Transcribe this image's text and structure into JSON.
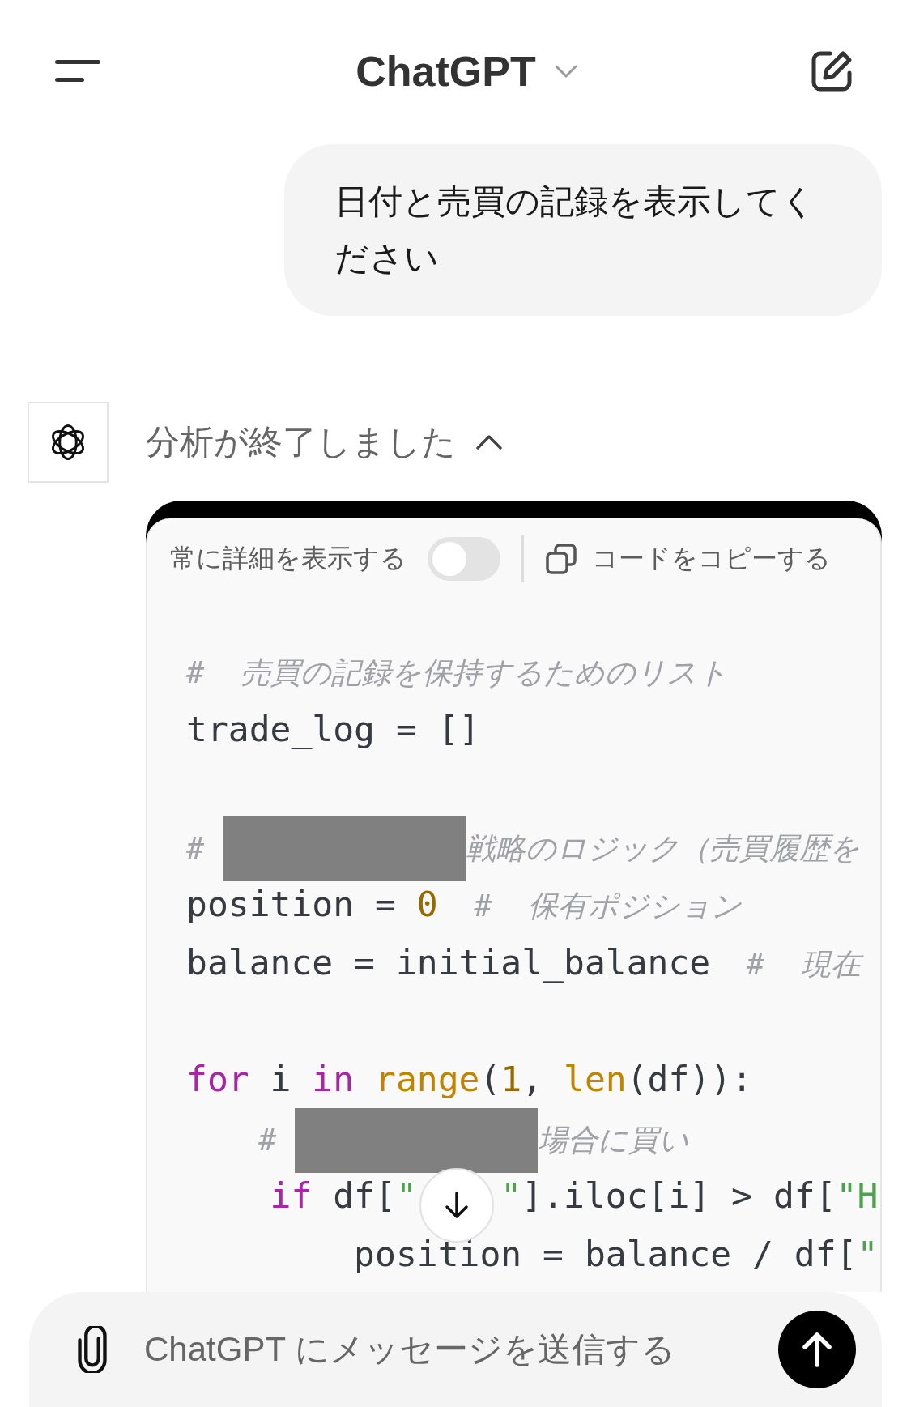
{
  "header": {
    "title": "ChatGPT"
  },
  "user_message": "日付と売買の記録を表示してください",
  "assistant": {
    "status": "分析が終了しました",
    "expanded": true,
    "code_panel": {
      "toggle": {
        "label": "常に詳細を表示する",
        "on": false
      },
      "copy_label": "コードをコピーする",
      "lines": [
        {
          "kind": "code",
          "tokens": [
            {
              "kind": "comment",
              "text": "#  売買の記録を保持するためのリスト"
            }
          ]
        },
        {
          "kind": "code",
          "tokens": [
            {
              "kind": "plain",
              "text": "trade_log = []"
            }
          ]
        },
        {
          "kind": "blank"
        },
        {
          "kind": "code",
          "tokens": [
            {
              "kind": "comment",
              "text": "# "
            },
            {
              "kind": "redacted"
            },
            {
              "kind": "comment",
              "text": "戦略のロジック（売買履歴を"
            }
          ]
        },
        {
          "kind": "code",
          "tokens": [
            {
              "kind": "plain",
              "text": "position = "
            },
            {
              "kind": "number",
              "text": "0"
            },
            {
              "kind": "comment",
              "text": "  #  保有ポジション"
            }
          ]
        },
        {
          "kind": "code",
          "tokens": [
            {
              "kind": "plain",
              "text": "balance = initial_balance"
            },
            {
              "kind": "comment",
              "text": "  #  現在"
            }
          ]
        },
        {
          "kind": "blank"
        },
        {
          "kind": "code",
          "tokens": [
            {
              "kind": "keyword",
              "text": "for"
            },
            {
              "kind": "plain",
              "text": " i "
            },
            {
              "kind": "keyword",
              "text": "in"
            },
            {
              "kind": "builtin",
              "text": " range"
            },
            {
              "kind": "plain",
              "text": "("
            },
            {
              "kind": "number",
              "text": "1"
            },
            {
              "kind": "plain",
              "text": ", "
            },
            {
              "kind": "builtin",
              "text": "len"
            },
            {
              "kind": "plain",
              "text": "(df)):"
            }
          ]
        },
        {
          "kind": "code",
          "tokens": [
            {
              "kind": "comment",
              "text": "    # "
            },
            {
              "kind": "redacted"
            },
            {
              "kind": "comment",
              "text": "場合に買い"
            }
          ]
        },
        {
          "kind": "code",
          "tokens": [
            {
              "kind": "keyword",
              "text": "    if"
            },
            {
              "kind": "plain",
              "text": " df["
            },
            {
              "kind": "string",
              "text": "\""
            },
            {
              "kind": "gap"
            },
            {
              "kind": "string",
              "text": "\""
            },
            {
              "kind": "plain",
              "text": "].iloc[i] > df["
            },
            {
              "kind": "string",
              "text": "\"H"
            }
          ]
        },
        {
          "kind": "code",
          "tokens": [
            {
              "kind": "plain",
              "text": "        position = balance / df["
            },
            {
              "kind": "string",
              "text": "\""
            }
          ]
        }
      ]
    }
  },
  "composer": {
    "placeholder": "ChatGPT にメッセージを送信する"
  }
}
